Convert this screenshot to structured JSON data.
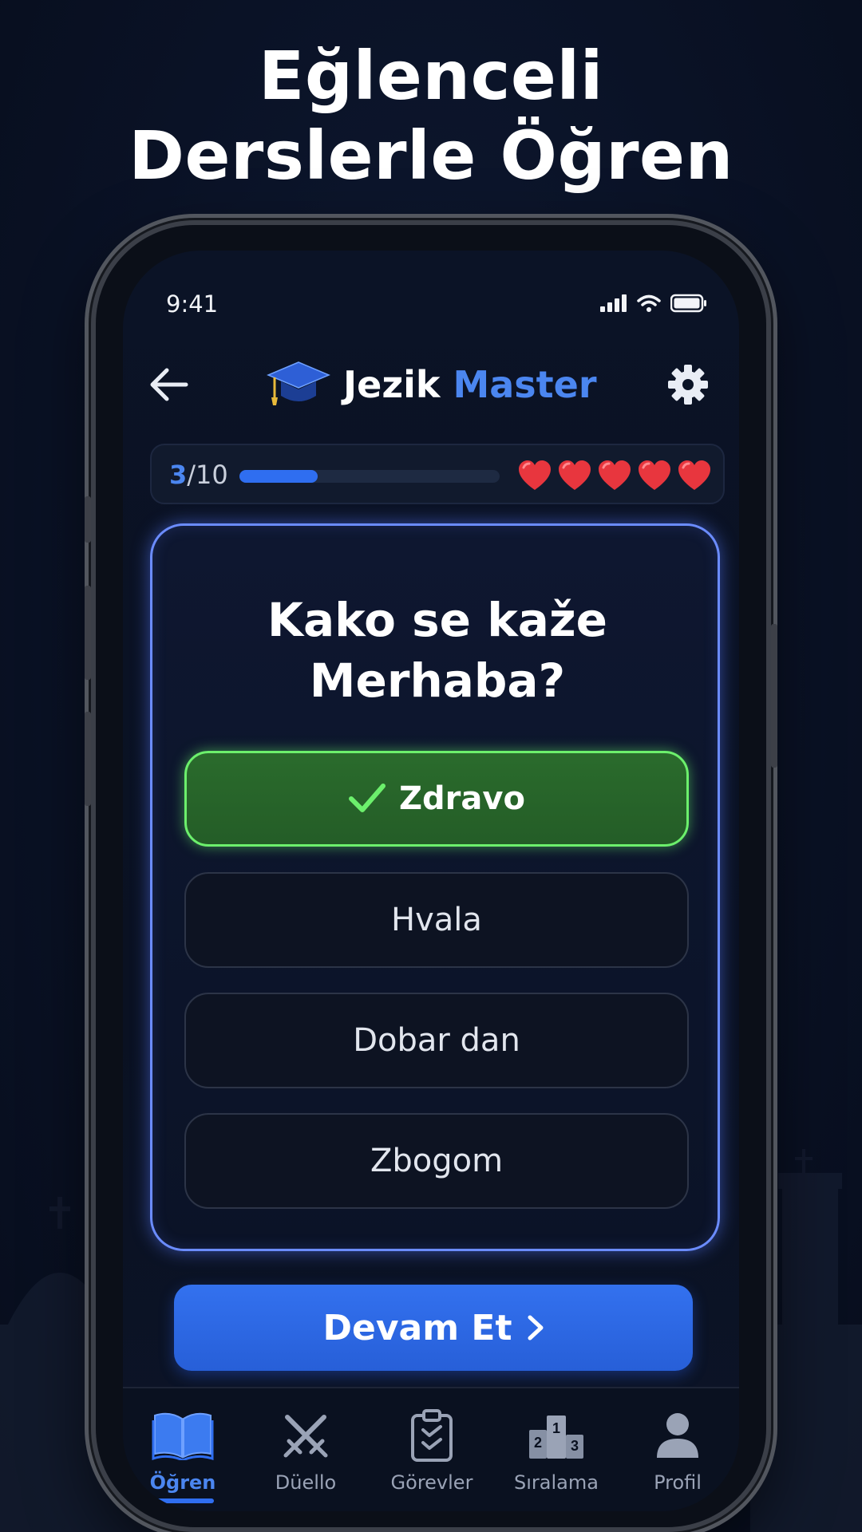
{
  "headline": {
    "line1": "Eğlenceli",
    "line2": "Derslerle Öğren"
  },
  "status_bar": {
    "time": "9:41"
  },
  "header": {
    "brand_main": "Jezik",
    "brand_accent": "Master"
  },
  "progress": {
    "current": "3",
    "total": "/10",
    "fraction": 0.3,
    "lives": 5
  },
  "question": {
    "line1": "Kako se kaže",
    "line2": "Merhaba?"
  },
  "answers": [
    {
      "label": "Zdravo",
      "state": "correct"
    },
    {
      "label": "Hvala"
    },
    {
      "label": "Dobar dan"
    },
    {
      "label": "Zbogom"
    }
  ],
  "continue_button": {
    "label": "Devam Et"
  },
  "tabs": [
    {
      "label": "Öğren",
      "icon": "open-book-icon",
      "active": true
    },
    {
      "label": "Düello",
      "icon": "crossed-swords-icon"
    },
    {
      "label": "Görevler",
      "icon": "clipboard-checklist-icon"
    },
    {
      "label": "Sıralama",
      "icon": "podium-icon"
    },
    {
      "label": "Profil",
      "icon": "user-icon"
    }
  ],
  "colors": {
    "accent": "#2f6ef0",
    "correct": "#6cf06c",
    "card_glow": "#6b8cff",
    "heart": "#e8363e"
  }
}
